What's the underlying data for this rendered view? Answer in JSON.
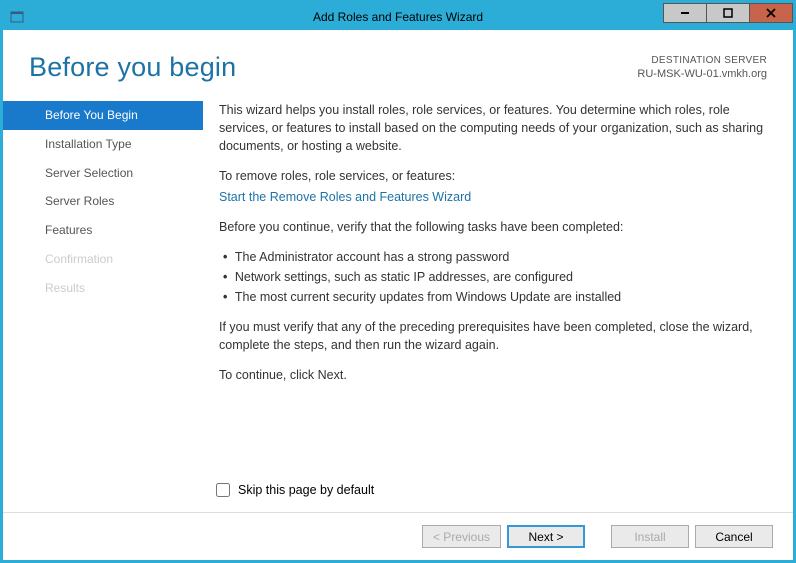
{
  "window": {
    "title": "Add Roles and Features Wizard"
  },
  "header": {
    "page_title": "Before you begin",
    "dest_label": "DESTINATION SERVER",
    "dest_server": "RU-MSK-WU-01.vmkh.org"
  },
  "sidebar": {
    "items": [
      {
        "label": "Before You Begin"
      },
      {
        "label": "Installation Type"
      },
      {
        "label": "Server Selection"
      },
      {
        "label": "Server Roles"
      },
      {
        "label": "Features"
      },
      {
        "label": "Confirmation"
      },
      {
        "label": "Results"
      }
    ]
  },
  "content": {
    "intro": "This wizard helps you install roles, role services, or features. You determine which roles, role services, or features to install based on the computing needs of your organization, such as sharing documents, or hosting a website.",
    "remove_label": "To remove roles, role services, or features:",
    "remove_link": "Start the Remove Roles and Features Wizard",
    "verify_label": "Before you continue, verify that the following tasks have been completed:",
    "bullets": [
      "The Administrator account has a strong password",
      "Network settings, such as static IP addresses, are configured",
      "The most current security updates from Windows Update are installed"
    ],
    "note": "If you must verify that any of the preceding prerequisites have been completed, close the wizard, complete the steps, and then run the wizard again.",
    "continue_text": "To continue, click Next.",
    "skip_label": "Skip this page by default"
  },
  "footer": {
    "previous": "< Previous",
    "next": "Next >",
    "install": "Install",
    "cancel": "Cancel"
  }
}
